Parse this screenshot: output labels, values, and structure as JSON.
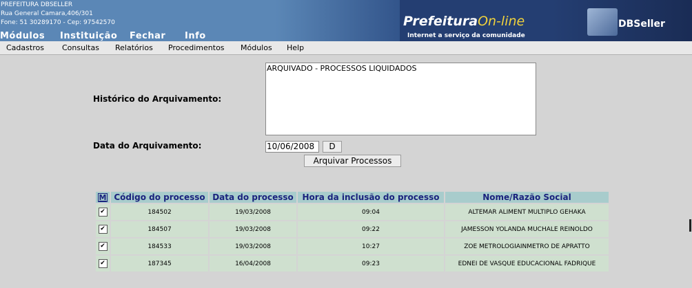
{
  "header": {
    "org_name": "PREFEITURA DBSELLER",
    "address": "Rua General Camara,406/301",
    "contact": "Fone: 51 30289170  -  Cep: 97542570",
    "main_menu": [
      "Módulos",
      "Instituição",
      "Fechar",
      "Info"
    ],
    "portal_logo_word1": "Prefeitura",
    "portal_logo_word2": "On-line",
    "portal_tagline": "Internet a serviço da comunidade",
    "vendor_logo": "DBSeller",
    "colors": {
      "header_bg": "#5b87b6",
      "accent_yellow": "#f0d23c"
    }
  },
  "submenu": [
    "Cadastros",
    "Consultas",
    "Relatórios",
    "Procedimentos",
    "Módulos",
    "Help"
  ],
  "form": {
    "historico_label": "Histórico do Arquivamento:",
    "historico_value": "ARQUIVADO - PROCESSOS LIQUIDADOS",
    "data_label": "Data do Arquivamento:",
    "data_value": "10/06/2008",
    "date_button": "D",
    "submit_button": "Arquivar Processos"
  },
  "table": {
    "mark_all": "M",
    "columns": [
      "Código do processo",
      "Data do processo",
      "Hora da inclusão do processo",
      "Nome/Razão Social"
    ],
    "rows": [
      {
        "checked": "✔",
        "codigo": "184502",
        "data": "19/03/2008",
        "hora": "09:04",
        "nome": "ALTEMAR ALIMENT MULTIPLO GEHAKA"
      },
      {
        "checked": "✔",
        "codigo": "184507",
        "data": "19/03/2008",
        "hora": "09:22",
        "nome": "JAMESSON YOLANDA MUCHALE REINOLDO"
      },
      {
        "checked": "✔",
        "codigo": "184533",
        "data": "19/03/2008",
        "hora": "10:27",
        "nome": "ZOE METROLOGIAINMETRO DE APRATTO"
      },
      {
        "checked": "✔",
        "codigo": "187345",
        "data": "16/04/2008",
        "hora": "09:23",
        "nome": "EDNEI DE VASQUE EDUCACIONAL FADRIQUE"
      }
    ],
    "colors": {
      "header_bg": "#a8cccc",
      "row_bg": "#cfe0cf",
      "header_text": "#1a237e"
    }
  }
}
